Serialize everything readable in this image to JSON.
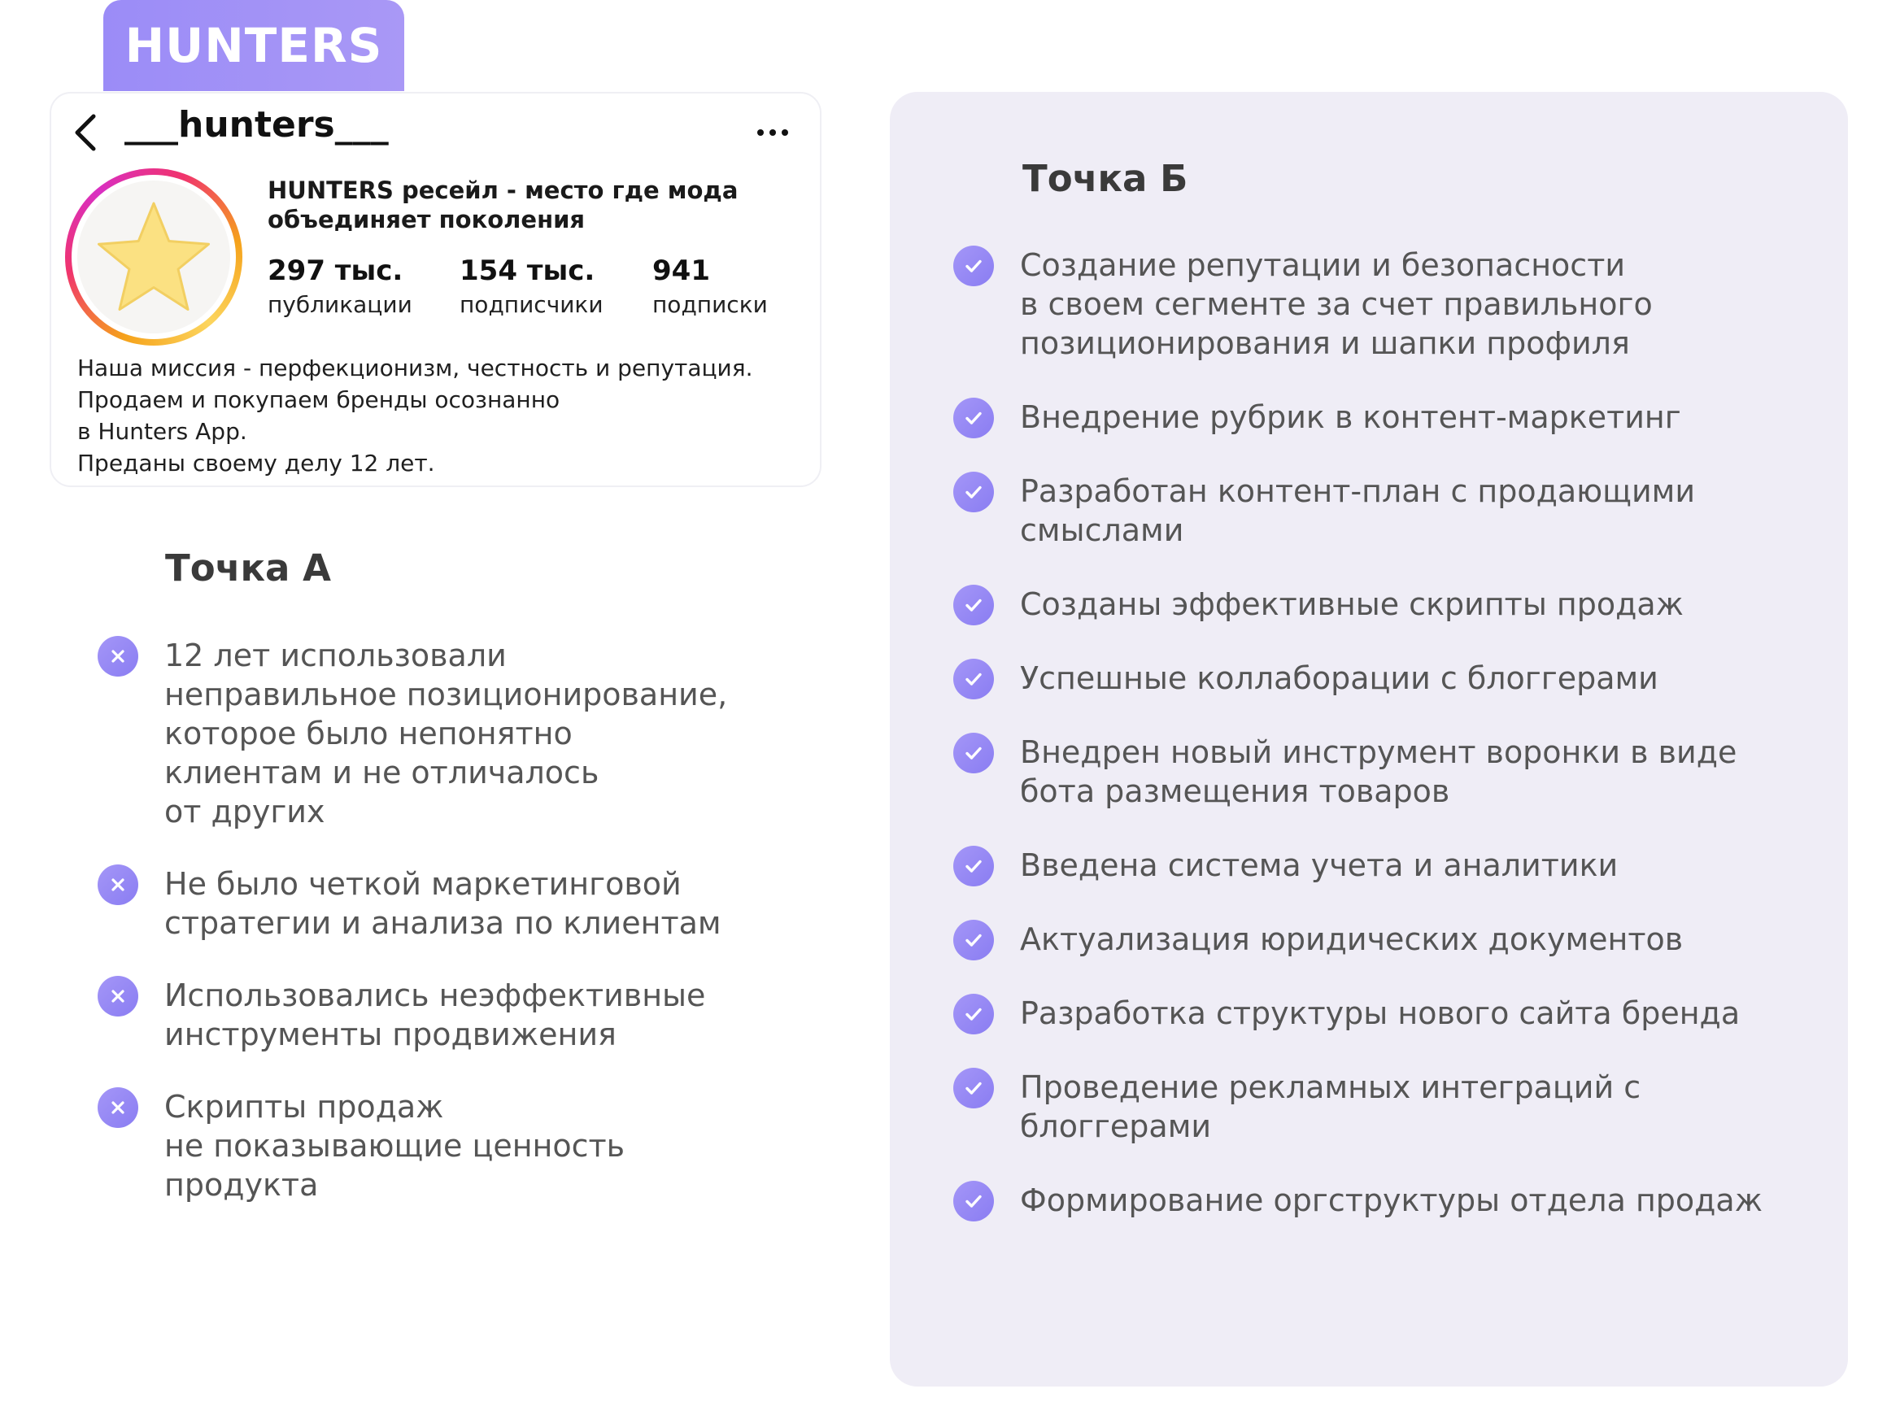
{
  "brand": {
    "label": "HUNTERS"
  },
  "profile": {
    "username": "___hunters___",
    "name_line1": "HUNTERS ресейл - место где мода",
    "name_line2": "объединяет поколения",
    "stats": [
      {
        "value": "297 тыс.",
        "label": "публикации"
      },
      {
        "value": "154 тыс.",
        "label": "подписчики"
      },
      {
        "value": "941",
        "label": "подписки"
      }
    ],
    "bio": [
      "Наша миссия - перфекционизм, честность и репутация.",
      "Продаем и покупаем бренды осознанно",
      "в Hunters App.",
      "Преданы своему делу 12 лет."
    ],
    "icons": {
      "back": "chevron-left-icon",
      "more": "more-horizontal-icon",
      "avatar": "star-icon"
    },
    "colors": {
      "avatar_star": "#fbe182"
    }
  },
  "point_a": {
    "title": "Точка А",
    "items": [
      [
        "12 лет использовали",
        "неправильное позиционирование,",
        "которое было непонятно",
        "клиентам и не отличалось",
        "от других"
      ],
      [
        "Не было четкой маркетинговой",
        "стратегии и анализа по клиентам"
      ],
      [
        "Использовались неэффективные",
        "инструменты продвижения"
      ],
      [
        "Скрипты продаж",
        "не показывающие ценность",
        "продукта"
      ]
    ]
  },
  "point_b": {
    "title": "Точка Б",
    "items": [
      [
        "Создание репутации и безопасности",
        "в своем сегменте за счет правильного",
        "позиционирования и шапки профиля"
      ],
      [
        "Внедрение рубрик в контент-маркетинг"
      ],
      [
        "Разработан контент-план с продающими",
        "смыслами"
      ],
      [
        "Созданы эффективные скрипты продаж"
      ],
      [
        "Успешные коллаборации с блоггерами"
      ],
      [
        "Внедрен новый инструмент воронки в виде",
        "бота размещения товаров"
      ],
      [
        "Введена система учета и аналитики"
      ],
      [
        "Актуализация юридических документов"
      ],
      [
        "Разработка структуры нового сайта бренда"
      ],
      [
        "Проведение рекламных интеграций с",
        "блоггерами"
      ],
      [
        "Формирование оргструктуры отдела продаж"
      ]
    ]
  },
  "colors": {
    "accent": "#9b8cf7",
    "panel_b_bg": "#efedf6",
    "text_muted": "#555555"
  }
}
